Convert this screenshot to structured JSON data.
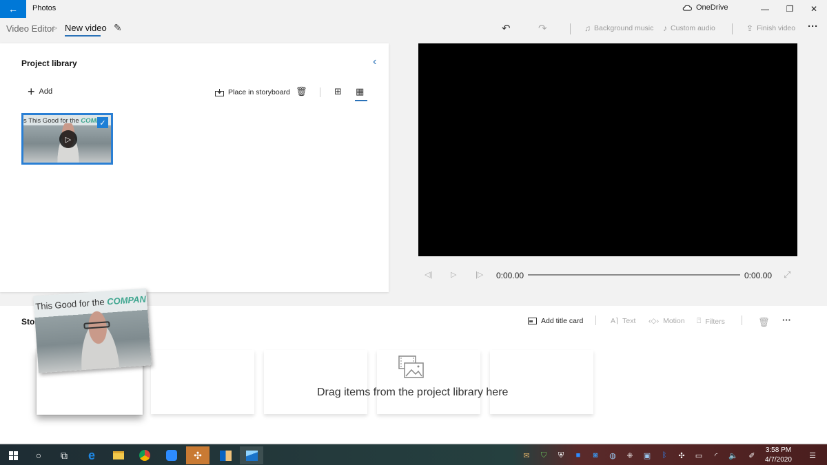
{
  "window": {
    "app_title": "Photos",
    "onedrive_label": "OneDrive",
    "controls": {
      "minimize": "—",
      "maximize": "❐",
      "close": "✕"
    }
  },
  "nav": {
    "breadcrumb_root": "Video Editor",
    "breadcrumb_separator": ">",
    "breadcrumb_current": "New video",
    "toolbar": {
      "undo_icon": "↶",
      "redo_icon": "↷",
      "background_music": "Background music",
      "custom_audio": "Custom audio",
      "finish_video": "Finish video",
      "more": "···"
    }
  },
  "library": {
    "title": "Project library",
    "add_label": "Add",
    "place_label": "Place in storyboard",
    "item": {
      "caption_text": "s This Good for the ",
      "caption_highlight": "COMPA",
      "selected": true
    }
  },
  "preview": {
    "current_time": "0:00.00",
    "total_time": "0:00.00",
    "progress_fraction": 0
  },
  "storyboard": {
    "title": "Storyboard",
    "visible_title": "Story",
    "add_title_card": "Add title card",
    "text": "Text",
    "motion": "Motion",
    "filters": "Filters",
    "more": "···",
    "drop_hint": "Drag items from the project library here",
    "drag_preview": {
      "caption_text": "This Good for the ",
      "caption_highlight": "COMPANY"
    }
  },
  "taskbar": {
    "pinned": [
      "start",
      "search",
      "task-view",
      "edge",
      "file-explorer",
      "chrome",
      "zoom",
      "slack",
      "outlook",
      "photos"
    ],
    "tray": [
      "mail",
      "security",
      "defender",
      "zoom",
      "outlook",
      "app",
      "dropbox",
      "vpn",
      "bluetooth",
      "slack",
      "battery",
      "wifi",
      "volume",
      "pen"
    ],
    "time": "3:58 PM",
    "date": "4/7/2020"
  },
  "colors": {
    "accent": "#0078d7",
    "selection": "#2a7fd4",
    "underline": "#2a72b8"
  }
}
